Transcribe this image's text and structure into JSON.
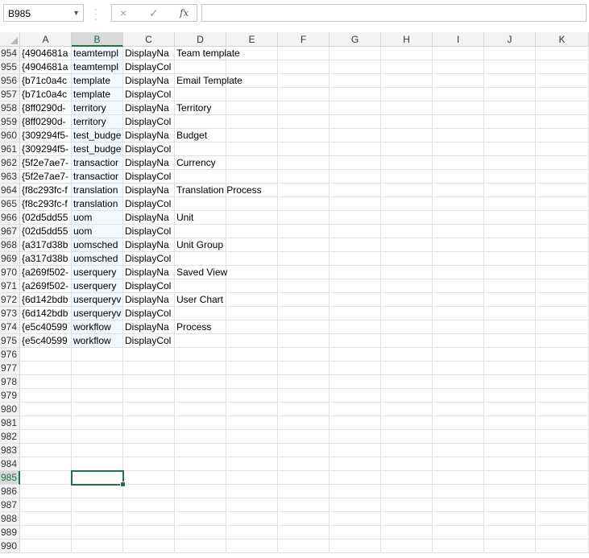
{
  "formula_bar": {
    "name_box": "B985",
    "name_box_dropdown_icon": "chevron-down-icon",
    "cancel_icon": "×",
    "enter_icon": "✓",
    "fx_label": "fx",
    "formula": ""
  },
  "columns": [
    "A",
    "B",
    "C",
    "D",
    "E",
    "F",
    "G",
    "H",
    "I",
    "J",
    "K"
  ],
  "selected_column": "B",
  "selected_row": 985,
  "rows": [
    {
      "n": 954,
      "a": "{4904681a",
      "b": "teamtempl",
      "c": "DisplayNa",
      "d": "Team template"
    },
    {
      "n": 955,
      "a": "{4904681a",
      "b": "teamtempl",
      "c": "DisplayCol",
      "d": ""
    },
    {
      "n": 956,
      "a": "{b71c0a4c",
      "b": "template",
      "c": "DisplayNa",
      "d": "Email Template"
    },
    {
      "n": 957,
      "a": "{b71c0a4c",
      "b": "template",
      "c": "DisplayCol",
      "d": ""
    },
    {
      "n": 958,
      "a": "{8ff0290d-",
      "b": "territory",
      "c": "DisplayNa",
      "d": "Territory"
    },
    {
      "n": 959,
      "a": "{8ff0290d-",
      "b": "territory",
      "c": "DisplayCol",
      "d": ""
    },
    {
      "n": 960,
      "a": "{309294f5-",
      "b": "test_budge",
      "c": "DisplayNa",
      "d": "Budget"
    },
    {
      "n": 961,
      "a": "{309294f5-",
      "b": "test_budge",
      "c": "DisplayCol",
      "d": ""
    },
    {
      "n": 962,
      "a": "{5f2e7ae7-",
      "b": "transactior",
      "c": "DisplayNa",
      "d": "Currency"
    },
    {
      "n": 963,
      "a": "{5f2e7ae7-",
      "b": "transactior",
      "c": "DisplayCol",
      "d": ""
    },
    {
      "n": 964,
      "a": "{f8c293fc-f",
      "b": "translation",
      "c": "DisplayNa",
      "d": "Translation Process"
    },
    {
      "n": 965,
      "a": "{f8c293fc-f",
      "b": "translation",
      "c": "DisplayCol",
      "d": ""
    },
    {
      "n": 966,
      "a": "{02d5dd55",
      "b": "uom",
      "c": "DisplayNa",
      "d": "Unit"
    },
    {
      "n": 967,
      "a": "{02d5dd55",
      "b": "uom",
      "c": "DisplayCol",
      "d": ""
    },
    {
      "n": 968,
      "a": "{a317d38b",
      "b": "uomsched",
      "c": "DisplayNa",
      "d": "Unit Group"
    },
    {
      "n": 969,
      "a": "{a317d38b",
      "b": "uomsched",
      "c": "DisplayCol",
      "d": ""
    },
    {
      "n": 970,
      "a": "{a269f502-",
      "b": "userquery",
      "c": "DisplayNa",
      "d": "Saved View"
    },
    {
      "n": 971,
      "a": "{a269f502-",
      "b": "userquery",
      "c": "DisplayCol",
      "d": ""
    },
    {
      "n": 972,
      "a": "{6d142bdb",
      "b": "userqueryv",
      "c": "DisplayNa",
      "d": "User Chart"
    },
    {
      "n": 973,
      "a": "{6d142bdb",
      "b": "userqueryv",
      "c": "DisplayCol",
      "d": ""
    },
    {
      "n": 974,
      "a": "{e5c40599",
      "b": "workflow",
      "c": "DisplayNa",
      "d": "Process"
    },
    {
      "n": 975,
      "a": "{e5c40599",
      "b": "workflow",
      "c": "DisplayCol",
      "d": ""
    },
    {
      "n": 976,
      "a": "",
      "b": "",
      "c": "",
      "d": ""
    },
    {
      "n": 977,
      "a": "",
      "b": "",
      "c": "",
      "d": ""
    },
    {
      "n": 978,
      "a": "",
      "b": "",
      "c": "",
      "d": ""
    },
    {
      "n": 979,
      "a": "",
      "b": "",
      "c": "",
      "d": ""
    },
    {
      "n": 980,
      "a": "",
      "b": "",
      "c": "",
      "d": ""
    },
    {
      "n": 981,
      "a": "",
      "b": "",
      "c": "",
      "d": ""
    },
    {
      "n": 982,
      "a": "",
      "b": "",
      "c": "",
      "d": ""
    },
    {
      "n": 983,
      "a": "",
      "b": "",
      "c": "",
      "d": ""
    },
    {
      "n": 984,
      "a": "",
      "b": "",
      "c": "",
      "d": ""
    },
    {
      "n": 985,
      "a": "",
      "b": "",
      "c": "",
      "d": ""
    },
    {
      "n": 986,
      "a": "",
      "b": "",
      "c": "",
      "d": ""
    },
    {
      "n": 987,
      "a": "",
      "b": "",
      "c": "",
      "d": ""
    },
    {
      "n": 988,
      "a": "",
      "b": "",
      "c": "",
      "d": ""
    },
    {
      "n": 989,
      "a": "",
      "b": "",
      "c": "",
      "d": ""
    },
    {
      "n": 990,
      "a": "",
      "b": "",
      "c": "",
      "d": ""
    }
  ]
}
